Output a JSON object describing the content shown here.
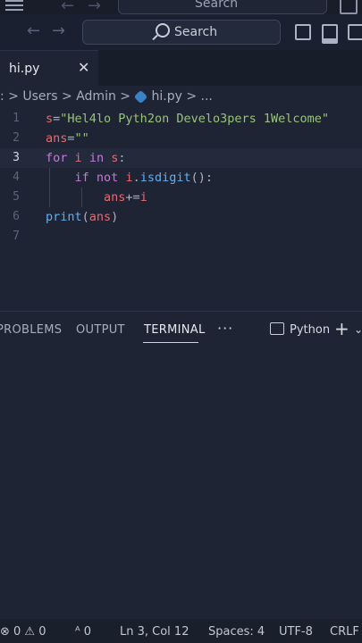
{
  "titlebar": {
    "search_label": "Search",
    "ghost_search_label": "Search"
  },
  "tab": {
    "label": "hi.py",
    "close_glyph": "✕"
  },
  "breadcrumb": {
    "lead": ":",
    "parts": [
      "Users",
      "Admin",
      "hi.py",
      "..."
    ],
    "sep": ">"
  },
  "editor": {
    "active_line": 3,
    "line_numbers": [
      "1",
      "2",
      "3",
      "4",
      "5",
      "6",
      "7"
    ]
  },
  "panel": {
    "tabs": [
      "PROBLEMS",
      "OUTPUT",
      "TERMINAL"
    ],
    "active_tab": "TERMINAL",
    "more": "···",
    "shell_label": "Python",
    "add_glyph": "+",
    "chevron": "⌄"
  },
  "statusbar": {
    "errors": "⊗ 0 ⚠ 0",
    "ports": "ᴬ 0",
    "position": "Ln 3, Col 12",
    "spaces": "Spaces: 4",
    "encoding": "UTF-8",
    "eol": "CRLF"
  },
  "colors": {
    "keyword": "#c678dd",
    "string": "#98c379",
    "function": "#61afef",
    "variable": "#e06c75"
  }
}
